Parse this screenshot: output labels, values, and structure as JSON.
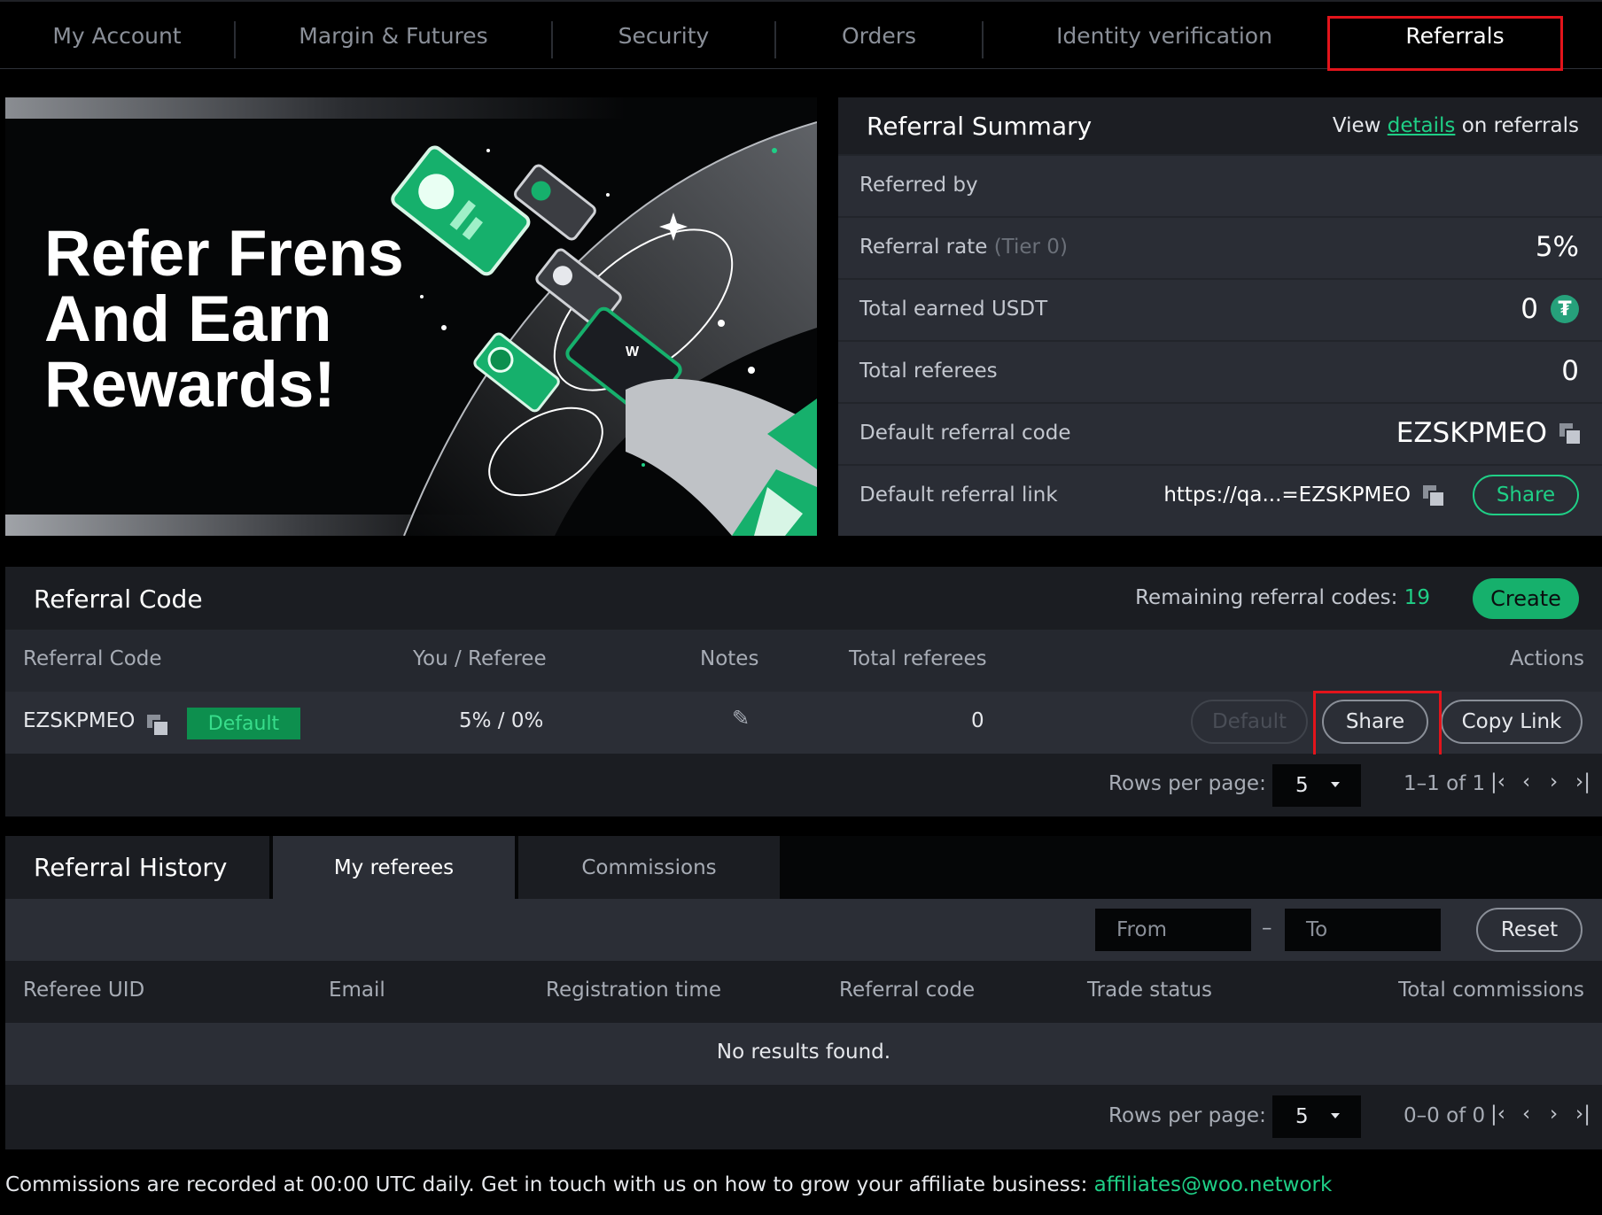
{
  "nav": {
    "tabs": [
      {
        "label": "My Account"
      },
      {
        "label": "Margin & Futures"
      },
      {
        "label": "Security"
      },
      {
        "label": "Orders"
      },
      {
        "label": "Identity verification"
      },
      {
        "label": "Referrals",
        "active": true
      }
    ]
  },
  "hero": {
    "line1": "Refer Frens",
    "line2": "And Earn",
    "line3": "Rewards!",
    "phone_mark": "W"
  },
  "summary": {
    "title": "Referral Summary",
    "view_prefix": "View",
    "view_link": "details",
    "view_suffix": "on referrals",
    "referred_by_label": "Referred by",
    "referral_rate_label": "Referral rate",
    "referral_rate_tier": "(Tier 0)",
    "referral_rate_value": "5%",
    "total_earned_label": "Total earned USDT",
    "total_earned_value": "0",
    "tether_symbol": "₮",
    "total_referees_label": "Total referees",
    "total_referees_value": "0",
    "default_code_label": "Default referral code",
    "default_code_value": "EZSKPMEO",
    "default_link_label": "Default referral link",
    "default_link_value": "https://qa...=EZSKPMEO",
    "share_label": "Share"
  },
  "referral_code": {
    "title": "Referral Code",
    "remaining_label": "Remaining referral codes:",
    "remaining_value": "19",
    "create_label": "Create",
    "columns": [
      "Referral Code",
      "You / Referee",
      "Notes",
      "Total referees",
      "Actions"
    ],
    "rows": [
      {
        "code": "EZSKPMEO",
        "badge": "Default",
        "split": "5% / 0%",
        "total_referees": "0",
        "btn_default": "Default",
        "btn_share": "Share",
        "btn_copy": "Copy Link"
      }
    ],
    "rows_per_page_label": "Rows per page:",
    "rows_per_page_value": "5",
    "range": "1–1 of 1"
  },
  "history": {
    "title": "Referral History",
    "tabs": [
      "My referees",
      "Commissions"
    ],
    "from_placeholder": "From",
    "dash": "–",
    "to_placeholder": "To",
    "reset_label": "Reset",
    "columns": [
      "Referee UID",
      "Email",
      "Registration time",
      "Referral code",
      "Trade status",
      "Total commissions"
    ],
    "empty": "No results found.",
    "rows_per_page_label": "Rows per page:",
    "rows_per_page_value": "5",
    "range": "0–0 of 0"
  },
  "footer": {
    "text": "Commissions are recorded at 00:00 UTC daily. Get in touch with us on how to grow your affiliate business:",
    "email": "affiliates@woo.network"
  },
  "colors": {
    "accent_green": "#1fcf86",
    "button_green": "#16b06c",
    "highlight_red": "#e3141b",
    "panel": "#2a2d35",
    "background": "#000000"
  }
}
